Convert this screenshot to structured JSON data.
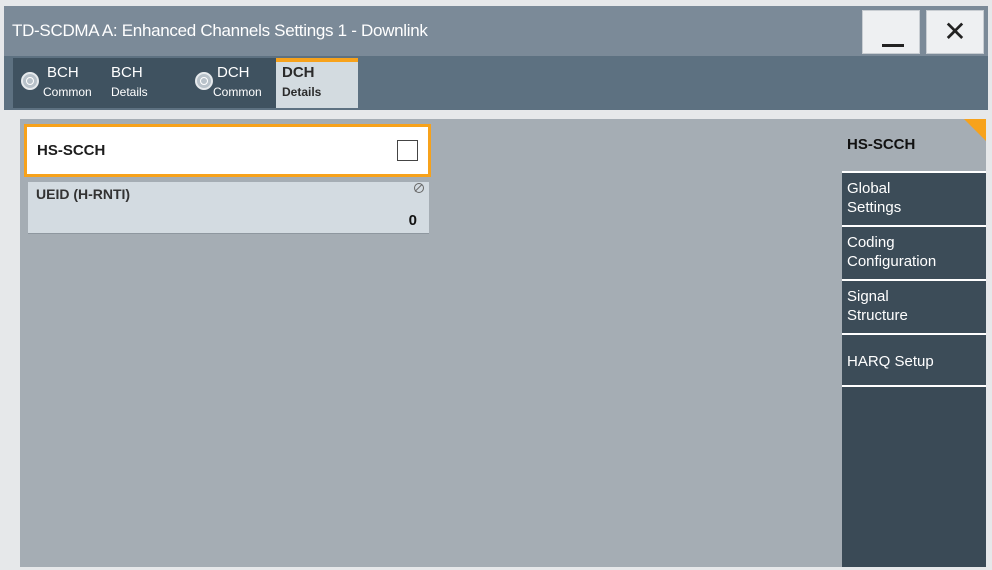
{
  "window": {
    "title": "TD-SCDMA A: Enhanced Channels Settings 1 - Downlink",
    "minimize_label": "—",
    "close_label": "✕"
  },
  "tabs": [
    {
      "line1": "BCH",
      "line2": "Common",
      "has_indicator": true,
      "active": false
    },
    {
      "line1": "BCH",
      "line2": "Details",
      "has_indicator": false,
      "active": false
    },
    {
      "line1": "DCH",
      "line2": "Common",
      "has_indicator": true,
      "active": false
    },
    {
      "line1": "DCH",
      "line2": "Details",
      "has_indicator": false,
      "active": true
    }
  ],
  "hs_scch": {
    "label": "HS-SCCH",
    "checked": false
  },
  "ueid": {
    "label": "UEID (H-RNTI)",
    "value": "0"
  },
  "sidenav": {
    "header": "HS-SCCH",
    "items": [
      {
        "line1": "Global",
        "line2": "Settings"
      },
      {
        "line1": "Coding",
        "line2": "Configuration"
      },
      {
        "line1": "Signal",
        "line2": "Structure"
      },
      {
        "line1": "HARQ Setup",
        "line2": ""
      }
    ]
  },
  "colors": {
    "accent": "#f7a21b",
    "titlebar": "#7b8a98",
    "tabbar": "#5d7181",
    "tab": "#3f5260",
    "content": "#a5adb4",
    "sidenav": "#3a4a56"
  }
}
